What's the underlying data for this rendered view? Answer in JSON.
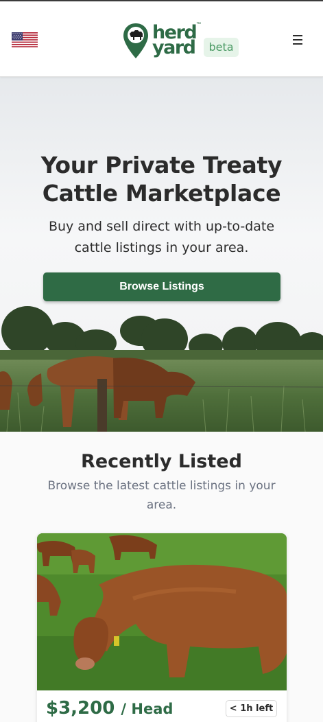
{
  "header": {
    "flag_icon": "us-flag-icon",
    "logo": {
      "line1": "herd",
      "line2": "yard",
      "tm": "™"
    },
    "beta_label": "beta",
    "menu_icon": "hamburger-menu-icon"
  },
  "hero": {
    "title_line1": "Your Private Treaty",
    "title_line2": "Cattle Marketplace",
    "subtitle": "Buy and sell direct with up-to-date cattle listings in your area.",
    "cta_label": "Browse Listings"
  },
  "recent": {
    "title": "Recently Listed",
    "subtitle": "Browse the latest cattle listings in your area.",
    "listings": [
      {
        "price": "$3,200",
        "unit": "/ Head",
        "time_left": "< 1h left"
      }
    ]
  },
  "colors": {
    "brand_green": "#2f6b45",
    "beta_bg": "#e6f4e9",
    "beta_text": "#4a9a64",
    "muted_text": "#6b7281"
  }
}
